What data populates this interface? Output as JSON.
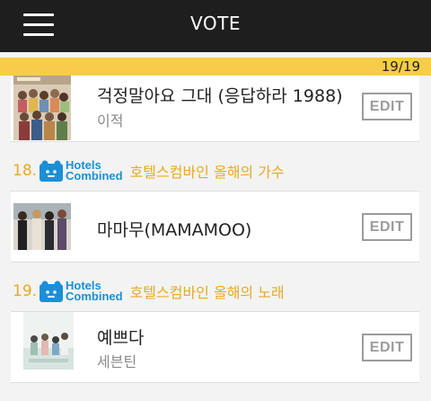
{
  "header": {
    "title": "VOTE",
    "progress": "19/19"
  },
  "items": [
    {
      "song": "걱정말아요 그대 (응답하라 1988)",
      "artist": "이적",
      "edit_label": "EDIT"
    },
    {
      "category": {
        "number": "18.",
        "sponsor_line1": "Hotels",
        "sponsor_line2": "Combined",
        "title": "호텔스컴바인 올해의 가수"
      },
      "song": "마마무(MAMAMOO)",
      "artist": "",
      "edit_label": "EDIT"
    },
    {
      "category": {
        "number": "19.",
        "sponsor_line1": "Hotels",
        "sponsor_line2": "Combined",
        "title": "호텔스컴바인 올해의 노래"
      },
      "song": "예쁘다",
      "artist": "세븐틴",
      "edit_label": "EDIT"
    }
  ],
  "colors": {
    "topbar": "#1e1e1e",
    "progress_bar": "#f6cc48",
    "category_text": "#e8a923",
    "sponsor_blue": "#1b8fd6",
    "edit_border": "#9c9c9c"
  },
  "icons": [
    "hamburger-menu-icon",
    "hotels-combined-logo-icon"
  ]
}
